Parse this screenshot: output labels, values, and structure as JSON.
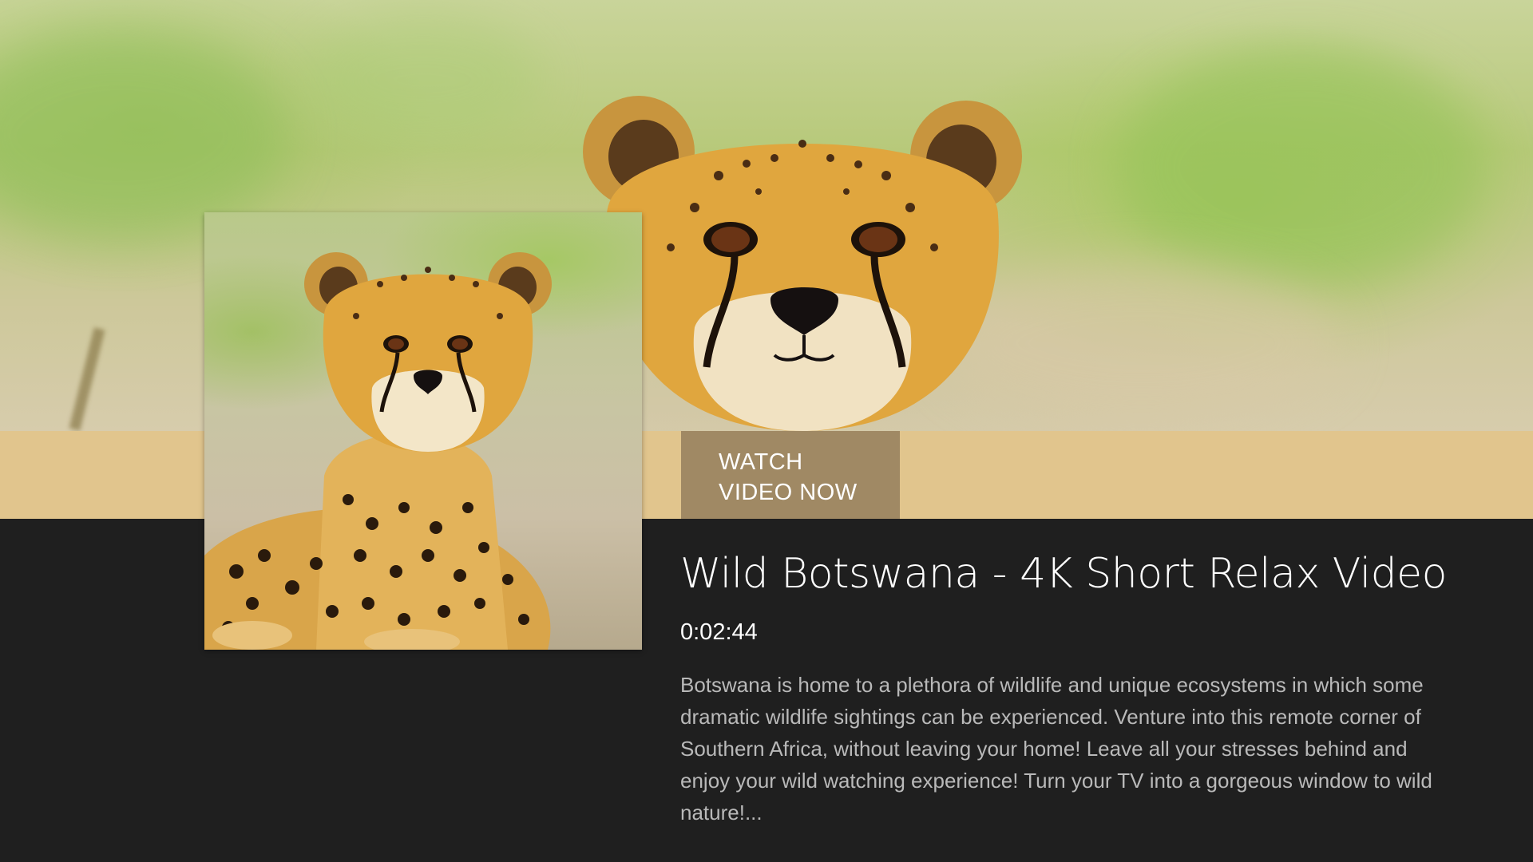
{
  "hero": {
    "image": "cheetah-face-photo"
  },
  "thumbnail": {
    "image": "cheetah-cub-lying-photo"
  },
  "action_bar": {
    "watch_label": "WATCH VIDEO NOW"
  },
  "video": {
    "title": "Wild Botswana - 4K Short Relax Video",
    "duration": "0:02:44",
    "description": "Botswana is home to a plethora of wildlife and unique ecosystems in which some dramatic wildlife sightings can be experienced. Venture into this remote corner of Southern Africa, without leaving your home!  Leave all your stresses behind and enjoy your wild watching experience! Turn your TV into a gorgeous window to wild nature!..."
  },
  "colors": {
    "action_bar": "#e1c58d",
    "watch_button": "#a08964",
    "panel_background": "#1f1f1f",
    "title_text": "#ffffff",
    "description_text": "#b9b9b9"
  }
}
